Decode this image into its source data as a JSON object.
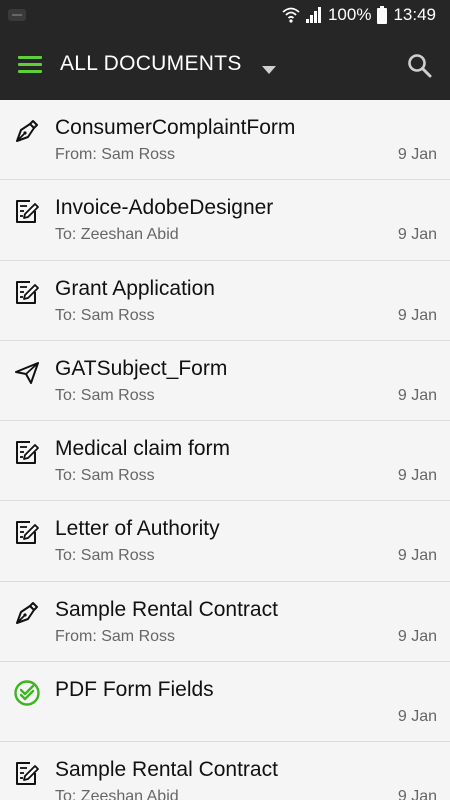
{
  "status_bar": {
    "battery": "100%",
    "time": "13:49"
  },
  "app_bar": {
    "title": "ALL DOCUMENTS",
    "accent_color": "#5fcf3a",
    "background": "#262626"
  },
  "documents": [
    {
      "title": "ConsumerComplaintForm",
      "subtitle": "From: Sam Ross",
      "date": "9 Jan",
      "icon": "pen-nib-icon"
    },
    {
      "title": "Invoice-AdobeDesigner",
      "subtitle": "To: Zeeshan Abid",
      "date": "9 Jan",
      "icon": "edit-document-icon"
    },
    {
      "title": "Grant Application",
      "subtitle": "To: Sam Ross",
      "date": "9 Jan",
      "icon": "edit-document-icon"
    },
    {
      "title": "GATSubject_Form",
      "subtitle": "To: Sam Ross",
      "date": "9 Jan",
      "icon": "paper-plane-icon"
    },
    {
      "title": "Medical claim form",
      "subtitle": "To: Sam Ross",
      "date": "9 Jan",
      "icon": "edit-document-icon"
    },
    {
      "title": "Letter of Authority",
      "subtitle": "To: Sam Ross",
      "date": "9 Jan",
      "icon": "edit-document-icon"
    },
    {
      "title": "Sample Rental Contract",
      "subtitle": "From: Sam Ross",
      "date": "9 Jan",
      "icon": "pen-nib-icon"
    },
    {
      "title": "PDF Form Fields",
      "subtitle": "",
      "date": "9 Jan",
      "icon": "completed-check-icon"
    },
    {
      "title": "Sample Rental Contract",
      "subtitle": "To: Zeeshan Abid",
      "date": "9 Jan",
      "icon": "edit-document-icon"
    }
  ]
}
